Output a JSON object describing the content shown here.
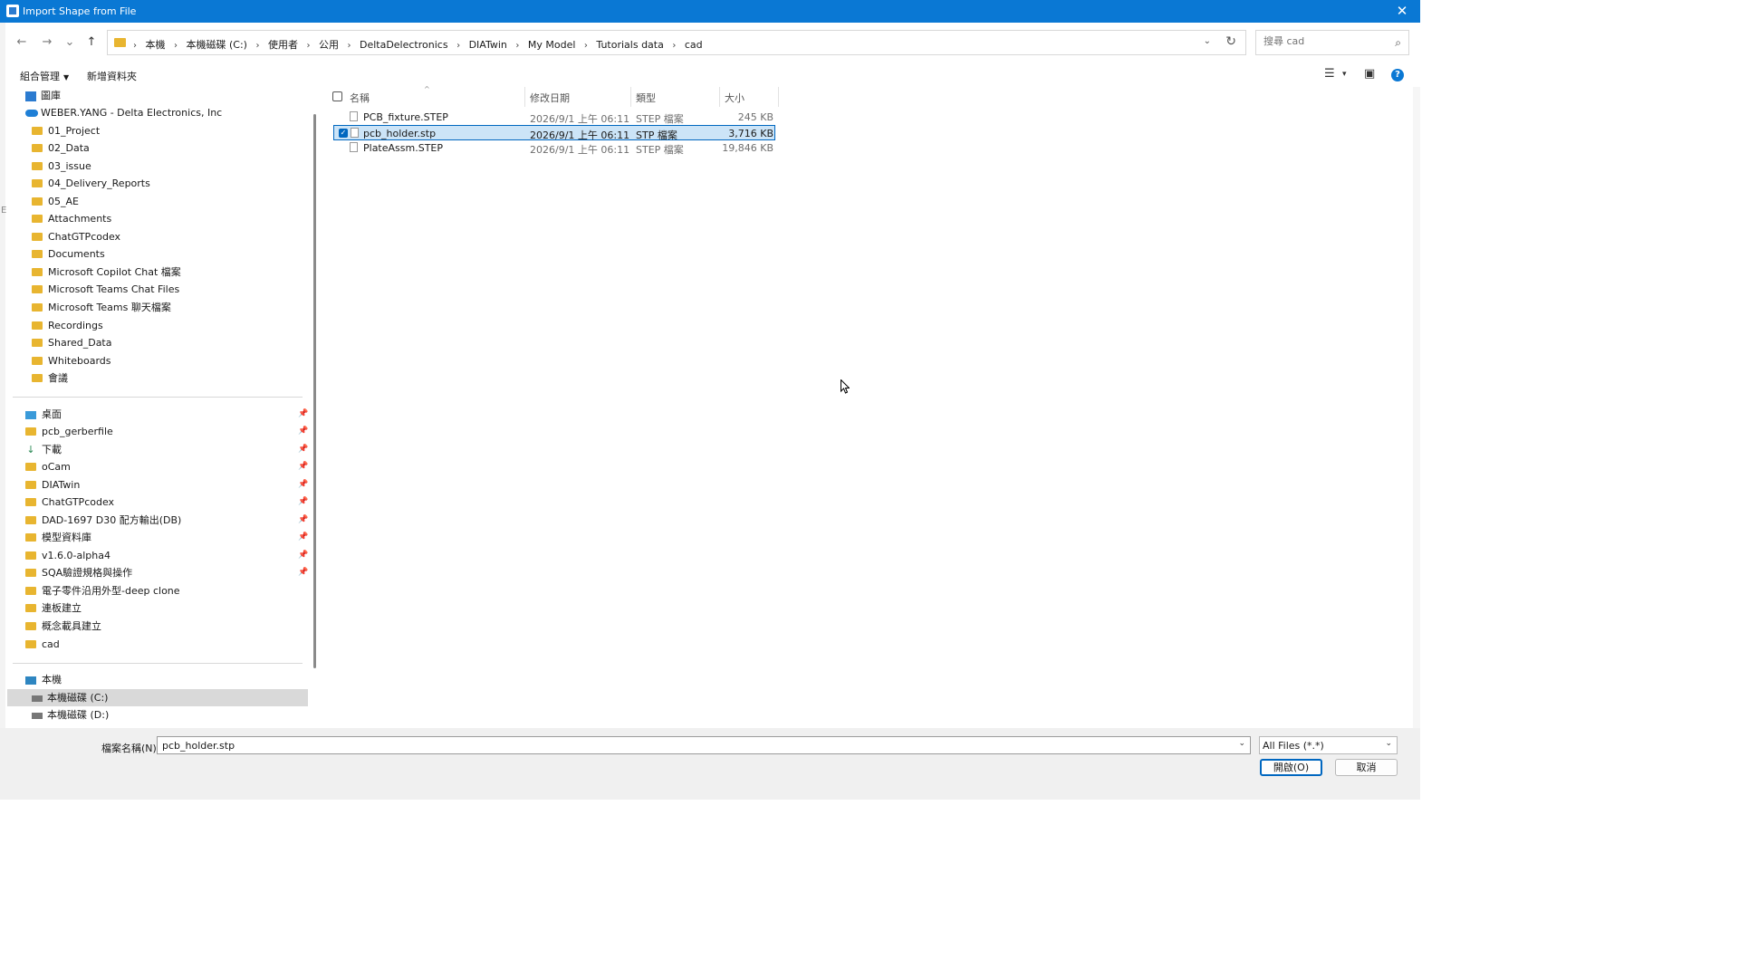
{
  "window": {
    "title": "Import Shape from File",
    "close_glyph": "✕"
  },
  "nav": {
    "back": "←",
    "forward": "→",
    "recent": "⌄",
    "up": "↑"
  },
  "address": {
    "crumbs": [
      "本機",
      "本機磁碟 (C:)",
      "使用者",
      "公用",
      "DeltaDelectronics",
      "DIATwin",
      "My Model",
      "Tutorials data",
      "cad"
    ],
    "separator": "›",
    "dropdown_glyph": "⌄",
    "refresh_glyph": "↻"
  },
  "search": {
    "placeholder": "搜尋 cad",
    "icon_glyph": "⌕"
  },
  "commandbar": {
    "organize": "組合管理",
    "organize_caret": "▼",
    "new_folder": "新增資料夾",
    "view_glyph": "☰",
    "view_caret": "▾",
    "preview_glyph": "▣",
    "help_glyph": "?"
  },
  "sidebar": {
    "gallery": "圖庫",
    "onedrive": "WEBER.YANG - Delta Electronics, Inc",
    "onedrive_folders": [
      "01_Project",
      "02_Data",
      "03_issue",
      "04_Delivery_Reports",
      "05_AE",
      "Attachments",
      "ChatGTPcodex",
      "Documents",
      "Microsoft Copilot Chat 檔案",
      "Microsoft Teams Chat Files",
      "Microsoft Teams 聊天檔案",
      "Recordings",
      "Shared_Data",
      "Whiteboards",
      "會議"
    ],
    "quick_access": [
      {
        "label": "桌面",
        "pinned": true
      },
      {
        "label": "pcb_gerberfile",
        "pinned": true
      },
      {
        "label": "下載",
        "pinned": true
      },
      {
        "label": "oCam",
        "pinned": true
      },
      {
        "label": "DIATwin",
        "pinned": true
      },
      {
        "label": "ChatGTPcodex",
        "pinned": true
      },
      {
        "label": "DAD-1697 D30 配方輸出(DB)",
        "pinned": true
      },
      {
        "label": "模型資料庫",
        "pinned": true
      },
      {
        "label": "v1.6.0-alpha4",
        "pinned": true
      },
      {
        "label": "SQA驗證規格與操作",
        "pinned": true
      },
      {
        "label": "電子零件沿用外型-deep clone",
        "pinned": false
      },
      {
        "label": "連板建立",
        "pinned": false
      },
      {
        "label": "概念載具建立",
        "pinned": false
      },
      {
        "label": "cad",
        "pinned": false
      }
    ],
    "pin_glyph": "📌",
    "this_pc": "本機",
    "drives": [
      "本機磁碟 (C:)",
      "本機磁碟 (D:)"
    ]
  },
  "file_list": {
    "columns": {
      "name": "名稱",
      "modified": "修改日期",
      "type": "類型",
      "size": "大小"
    },
    "sort_glyph": "^",
    "rows": [
      {
        "name": "PCB_fixture.STEP",
        "modified": "2026/9/1 上午 06:11",
        "type": "STEP 檔案",
        "size": "245 KB",
        "selected": false
      },
      {
        "name": "pcb_holder.stp",
        "modified": "2026/9/1 上午 06:11",
        "type": "STP 檔案",
        "size": "3,716 KB",
        "selected": true
      },
      {
        "name": "PlateAssm.STEP",
        "modified": "2026/9/1 上午 06:11",
        "type": "STEP 檔案",
        "size": "19,846 KB",
        "selected": false
      }
    ],
    "check_glyph": "✓"
  },
  "bottom": {
    "filename_label": "檔案名稱(N):",
    "filename_value": "pcb_holder.stp",
    "dropdown_glyph": "⌄",
    "filter": "All Files (*.*)",
    "open_button": "開啟(O)",
    "cancel_button": "取消"
  },
  "edge_mark": "E",
  "colors": {
    "accent": "#0a78d4",
    "selection": "#cce4f7",
    "folder": "#e8b530"
  }
}
